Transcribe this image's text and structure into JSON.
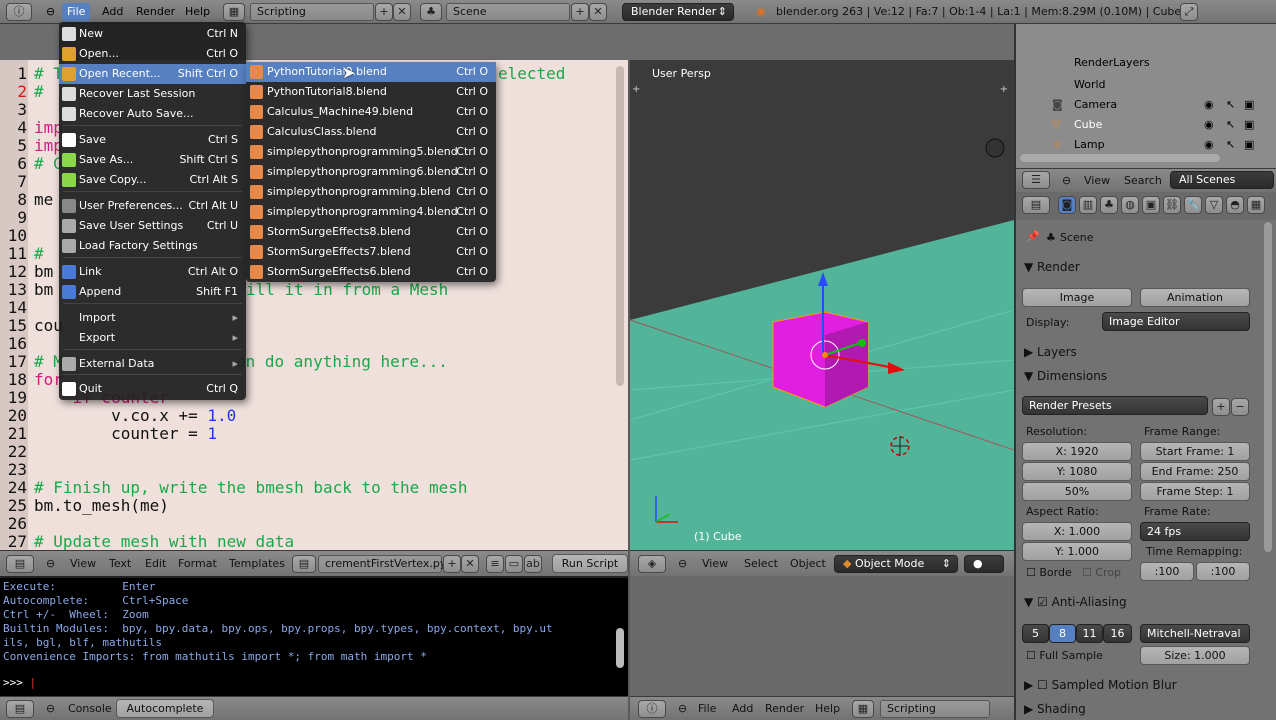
{
  "topbar": {
    "menus": [
      "File",
      "Add",
      "Render",
      "Help"
    ],
    "screen_layout": "Scripting",
    "scene": "Scene",
    "render_engine": "Blender Render",
    "stats": "blender.org 263 | Ve:12 | Fa:7 | Ob:1-4 | La:1 | Mem:8.29M (0.10M) | Cube"
  },
  "file_menu": {
    "items": [
      {
        "label": "New",
        "shortcut": "Ctrl N"
      },
      {
        "label": "Open...",
        "shortcut": "Ctrl O"
      },
      {
        "label": "Open Recent...",
        "shortcut": "Shift Ctrl O"
      },
      {
        "label": "Recover Last Session",
        "shortcut": ""
      },
      {
        "label": "Recover Auto Save...",
        "shortcut": ""
      },
      {
        "label": "Save",
        "shortcut": "Ctrl S"
      },
      {
        "label": "Save As...",
        "shortcut": "Shift Ctrl S"
      },
      {
        "label": "Save Copy...",
        "shortcut": "Ctrl Alt S"
      },
      {
        "label": "User Preferences...",
        "shortcut": "Ctrl Alt U"
      },
      {
        "label": "Save User Settings",
        "shortcut": "Ctrl U"
      },
      {
        "label": "Load Factory Settings",
        "shortcut": ""
      },
      {
        "label": "Link",
        "shortcut": "Ctrl Alt O"
      },
      {
        "label": "Append",
        "shortcut": "Shift F1"
      },
      {
        "label": "Import",
        "shortcut": ""
      },
      {
        "label": "Export",
        "shortcut": ""
      },
      {
        "label": "External Data",
        "shortcut": ""
      },
      {
        "label": "Quit",
        "shortcut": "Ctrl Q"
      }
    ]
  },
  "recent_menu": {
    "items": [
      {
        "label": "PythonTutorial9.blend",
        "shortcut": "Ctrl O"
      },
      {
        "label": "PythonTutorial8.blend",
        "shortcut": "Ctrl O"
      },
      {
        "label": "Calculus_Machine49.blend",
        "shortcut": "Ctrl O"
      },
      {
        "label": "CalculusClass.blend",
        "shortcut": "Ctrl O"
      },
      {
        "label": "simplepythonprogramming5.blend",
        "shortcut": "Ctrl O"
      },
      {
        "label": "simplepythonprogramming6.blend",
        "shortcut": "Ctrl O"
      },
      {
        "label": "simplepythonprogramming.blend",
        "shortcut": "Ctrl O"
      },
      {
        "label": "simplepythonprogramming4.blend",
        "shortcut": "Ctrl O"
      },
      {
        "label": "StormSurgeEffects8.blend",
        "shortcut": "Ctrl O"
      },
      {
        "label": "StormSurgeEffects7.blend",
        "shortcut": "Ctrl O"
      },
      {
        "label": "StormSurgeEffects6.blend",
        "shortcut": "Ctrl O"
      }
    ]
  },
  "code": {
    "visible_lines": [
      {
        "n": "1",
        "text": "# T",
        "tail": "elected"
      },
      {
        "n": "2",
        "text": "# ",
        "tail": ""
      },
      {
        "n": "3",
        "text": "",
        "tail": ""
      },
      {
        "n": "4",
        "text": "imp",
        "tail": ""
      },
      {
        "n": "5",
        "text": "imp",
        "tail": ""
      },
      {
        "n": "6",
        "text": "# G",
        "tail": ""
      },
      {
        "n": "7",
        "text": "",
        "tail": ""
      },
      {
        "n": "8",
        "text": "me",
        "tail": ""
      },
      {
        "n": "9",
        "text": "",
        "tail": ""
      },
      {
        "n": "10",
        "text": "",
        "tail": ""
      },
      {
        "n": "11",
        "text": "# ",
        "tail": ""
      },
      {
        "n": "12",
        "text": "bm",
        "tail": ""
      },
      {
        "n": "13",
        "text": "bm",
        "tail": "ill it in from a Mesh"
      },
      {
        "n": "14",
        "text": "",
        "tail": ""
      },
      {
        "n": "15",
        "text": "cou",
        "tail": ""
      },
      {
        "n": "16",
        "text": "",
        "tail": ""
      },
      {
        "n": "17",
        "text": "# M",
        "tail": "an do anything here..."
      },
      {
        "n": "18",
        "text": "for",
        "tail": ""
      },
      {
        "n": "19",
        "text": "    if counter",
        "tail": ""
      },
      {
        "n": "20",
        "text": "        v.co.x += ",
        "num": "1.0"
      },
      {
        "n": "21",
        "text": "        counter = ",
        "num": "1"
      },
      {
        "n": "22",
        "text": "",
        "tail": ""
      },
      {
        "n": "23",
        "text": "",
        "tail": ""
      },
      {
        "n": "24",
        "text": "# Finish up, write the bmesh back to the mesh",
        "tail": ""
      },
      {
        "n": "25",
        "text": "bm.to_mesh(me)",
        "tail": ""
      },
      {
        "n": "26",
        "text": "",
        "tail": ""
      },
      {
        "n": "27",
        "text": "# Update mesh with new data",
        "tail": ""
      }
    ]
  },
  "text_header": {
    "menus": [
      "View",
      "Text",
      "Edit",
      "Format",
      "Templates"
    ],
    "filename": "crementFirstVertex.py",
    "run_script": "Run Script"
  },
  "console": {
    "lines": [
      "Execute:          Enter",
      "Autocomplete:     Ctrl+Space",
      "Ctrl +/-  Wheel:  Zoom",
      "Builtin Modules:  bpy, bpy.data, bpy.ops, bpy.props, bpy.types, bpy.context, bpy.ut",
      "ils, bgl, blf, mathutils",
      "Convenience Imports: from mathutils import *; from math import *"
    ],
    "prompt": ">>> "
  },
  "console_header": {
    "console": "Console",
    "autocomplete": "Autocomplete"
  },
  "viewport": {
    "label": "User Persp",
    "object_label": "(1) Cube",
    "menus": [
      "View",
      "Select",
      "Object"
    ],
    "mode": "Object Mode"
  },
  "bottombar": {
    "menus": [
      "File",
      "Add",
      "Render",
      "Help"
    ],
    "layout": "Scripting"
  },
  "outliner": {
    "items": [
      "RenderLayers",
      "World",
      "Camera",
      "Cube",
      "Lamp"
    ],
    "view": "View",
    "search": "Search",
    "scenes": "All Scenes"
  },
  "properties": {
    "context": "Scene",
    "render_title": "Render",
    "image_btn": "Image",
    "animation_btn": "Animation",
    "display_label": "Display:",
    "display_value": "Image Editor",
    "layers": "Layers",
    "dimensions": "Dimensions",
    "render_presets": "Render Presets",
    "resolution_label": "Resolution:",
    "res_x": "X: 1920",
    "res_y": "Y: 1080",
    "res_pct": "50%",
    "frame_range_label": "Frame Range:",
    "start_frame": "Start Frame: 1",
    "end_frame": "End Frame: 250",
    "frame_step": "Frame Step: 1",
    "aspect_label": "Aspect Ratio:",
    "aspect_x": "X: 1.000",
    "aspect_y": "Y: 1.000",
    "frame_rate_label": "Frame Rate:",
    "frame_rate": "24 fps",
    "time_remap_label": "Time Remapping:",
    "remap_old": ":100",
    "remap_new": ":100",
    "border": "Borde",
    "crop": "Crop",
    "antialiasing": "Anti-Aliasing",
    "aa_samples": [
      "5",
      "8",
      "11",
      "16"
    ],
    "aa_filter": "Mitchell-Netraval",
    "full_sample": "Full Sample",
    "filter_size": "Size: 1.000",
    "motion_blur": "Sampled Motion Blur",
    "shading": "Shading"
  }
}
